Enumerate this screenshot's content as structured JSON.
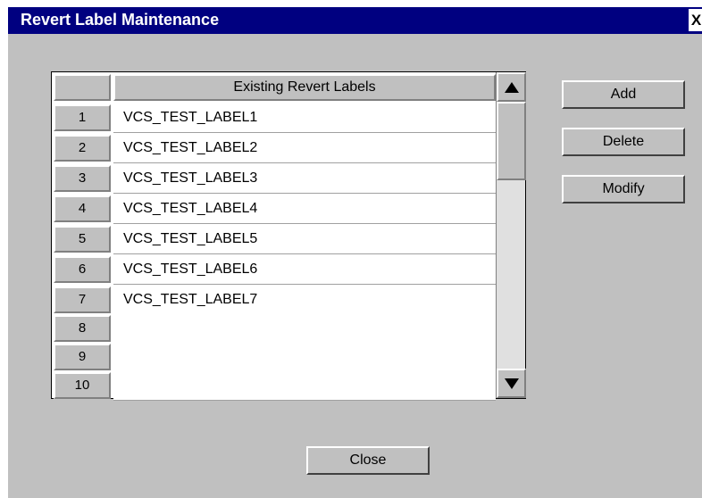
{
  "window": {
    "title": "Revert Label Maintenance",
    "close_glyph": "X"
  },
  "table": {
    "column_header": "Existing Revert Labels",
    "rows": [
      {
        "num": "1",
        "label": "VCS_TEST_LABEL1"
      },
      {
        "num": "2",
        "label": "VCS_TEST_LABEL2"
      },
      {
        "num": "3",
        "label": "VCS_TEST_LABEL3"
      },
      {
        "num": "4",
        "label": "VCS_TEST_LABEL4"
      },
      {
        "num": "5",
        "label": "VCS_TEST_LABEL5"
      },
      {
        "num": "6",
        "label": "VCS_TEST_LABEL6"
      },
      {
        "num": "7",
        "label": "VCS_TEST_LABEL7"
      },
      {
        "num": "8",
        "label": ""
      },
      {
        "num": "9",
        "label": ""
      },
      {
        "num": "10",
        "label": ""
      }
    ]
  },
  "buttons": {
    "add": "Add",
    "delete": "Delete",
    "modify": "Modify",
    "close": "Close"
  },
  "icons": {
    "scroll_up": "triangle-up-icon",
    "scroll_down": "triangle-down-icon"
  },
  "colors": {
    "title_bar": "#000080",
    "dialog_bg": "#c0c0c0"
  }
}
